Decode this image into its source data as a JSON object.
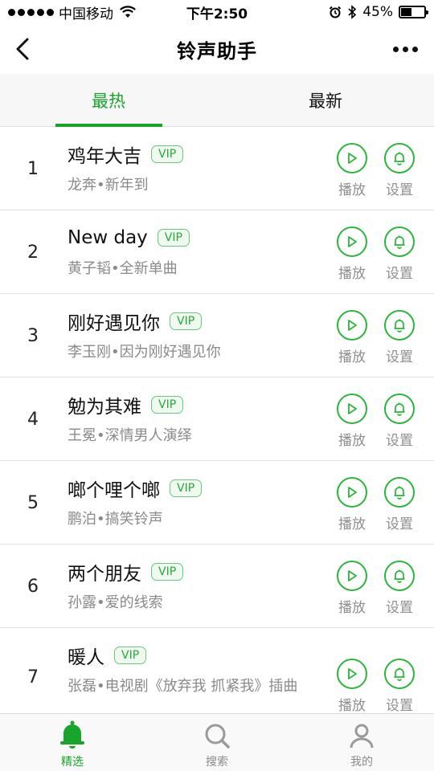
{
  "status_bar": {
    "carrier": "中国移动",
    "time": "下午2:50",
    "battery": "45%",
    "battery_level": 0.45
  },
  "nav": {
    "title": "铃声助手"
  },
  "tabs": [
    {
      "label": "最热",
      "active": true
    },
    {
      "label": "最新",
      "active": false
    }
  ],
  "songs": [
    {
      "rank": "1",
      "title": "鸡年大吉",
      "badge": "VIP",
      "subtitle": "龙奔•新年到",
      "play_label": "播放",
      "set_label": "设置"
    },
    {
      "rank": "2",
      "title": "New day",
      "badge": "VIP",
      "subtitle": "黄子韬•全新单曲",
      "play_label": "播放",
      "set_label": "设置"
    },
    {
      "rank": "3",
      "title": "刚好遇见你",
      "badge": "VIP",
      "subtitle": "李玉刚•因为刚好遇见你",
      "play_label": "播放",
      "set_label": "设置"
    },
    {
      "rank": "4",
      "title": "勉为其难",
      "badge": "VIP",
      "subtitle": "王冕•深情男人演绎",
      "play_label": "播放",
      "set_label": "设置"
    },
    {
      "rank": "5",
      "title": "啷个哩个啷",
      "badge": "VIP",
      "subtitle": "鹏泊•搞笑铃声",
      "play_label": "播放",
      "set_label": "设置"
    },
    {
      "rank": "6",
      "title": "两个朋友",
      "badge": "VIP",
      "subtitle": "孙露•爱的线索",
      "play_label": "播放",
      "set_label": "设置"
    },
    {
      "rank": "7",
      "title": "暖人",
      "badge": "VIP",
      "subtitle": "张磊•电视剧《放弃我 抓紧我》插曲",
      "play_label": "播放",
      "set_label": "设置"
    }
  ],
  "tab_bar": [
    {
      "label": "精选",
      "icon": "bell-icon",
      "active": true
    },
    {
      "label": "搜索",
      "icon": "search-icon",
      "active": false
    },
    {
      "label": "我的",
      "icon": "user-icon",
      "active": false
    }
  ],
  "colors": {
    "accent": "#19a42b",
    "subtitle": "#8a8a8a"
  }
}
